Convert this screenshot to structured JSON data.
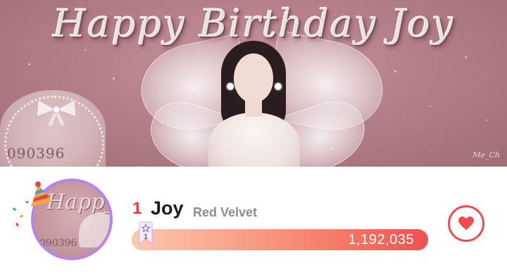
{
  "banner": {
    "title": "Happy Birthday Joy",
    "date_stamp": "090396",
    "signature": "Me_Ch"
  },
  "ranking": {
    "rank": "1",
    "artist": "Joy",
    "group": "Red Velvet",
    "votes": "1,192,035",
    "vote_bar_fill": 1.0,
    "badge_number": "1",
    "avatar": {
      "text": "Happy",
      "date_stamp": "090396"
    }
  },
  "icons": {
    "vote": "heart-icon",
    "celebration": "party-hat-icon",
    "rank_badge": "rank-ribbon-icon"
  },
  "colors": {
    "accent": "#e8383d",
    "avatar_ring": "#b882e6",
    "bar_start": "#fbc9b3",
    "bar_end": "#ef5152",
    "banner_bg": "#b58089"
  }
}
